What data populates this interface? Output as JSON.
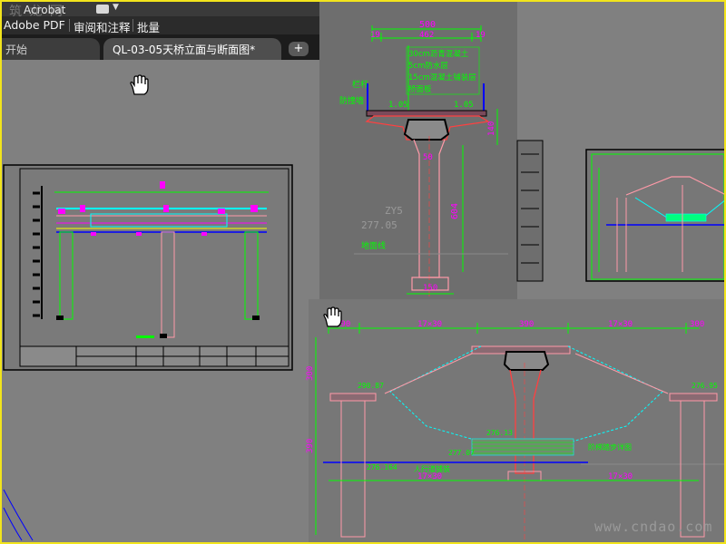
{
  "app": {
    "title": "Acrobat",
    "watermark": "筑 龙 网"
  },
  "menu": {
    "items": [
      "Adobe PDF",
      "审阅和注释",
      "批量"
    ]
  },
  "tabs": {
    "start": "开始",
    "active": "QL-03-05天桥立面与断面图*",
    "add": "+"
  },
  "cad": {
    "top_dims": [
      "500",
      "19",
      "462",
      "19"
    ],
    "layers": [
      "30cm沥青混凝土",
      "5cm防水层",
      "15cm混凝土铺装层",
      "桥面板"
    ],
    "rail_note": "栏杆",
    "guard_note": "防撞墙",
    "width_dims": [
      "1.05",
      "1.05"
    ],
    "slope": "1%",
    "right_dim": "140",
    "column_dim": "604",
    "base_dim": "150",
    "elevation_label": "ZY5",
    "elevation_value": "277.05",
    "ground_note": "地面线",
    "bottom_dims": [
      "390",
      "17×30",
      "390",
      "17×30",
      "300"
    ],
    "level_marks": [
      "290.87",
      "276.13",
      "277.07",
      "276.164",
      "276.95"
    ],
    "side_dims": [
      "300",
      "390"
    ],
    "lower_dims": [
      "17×30",
      "17×30"
    ],
    "note_right": "阶梯踏步详图",
    "note_left": "人行道铺装"
  },
  "footer": {
    "url": "www.cndao.com"
  },
  "colors": {
    "frame": "#f2e41c",
    "canvas": "#808080",
    "green": "#00ff00",
    "magenta": "#ff00ff",
    "cyan": "#00ffff",
    "blue": "#0000ff",
    "pink": "#ff9aa8",
    "dim_red": "#ff4040"
  },
  "icons": [
    "hand-tool-icon",
    "add-tab-icon",
    "dropdown-icon"
  ]
}
